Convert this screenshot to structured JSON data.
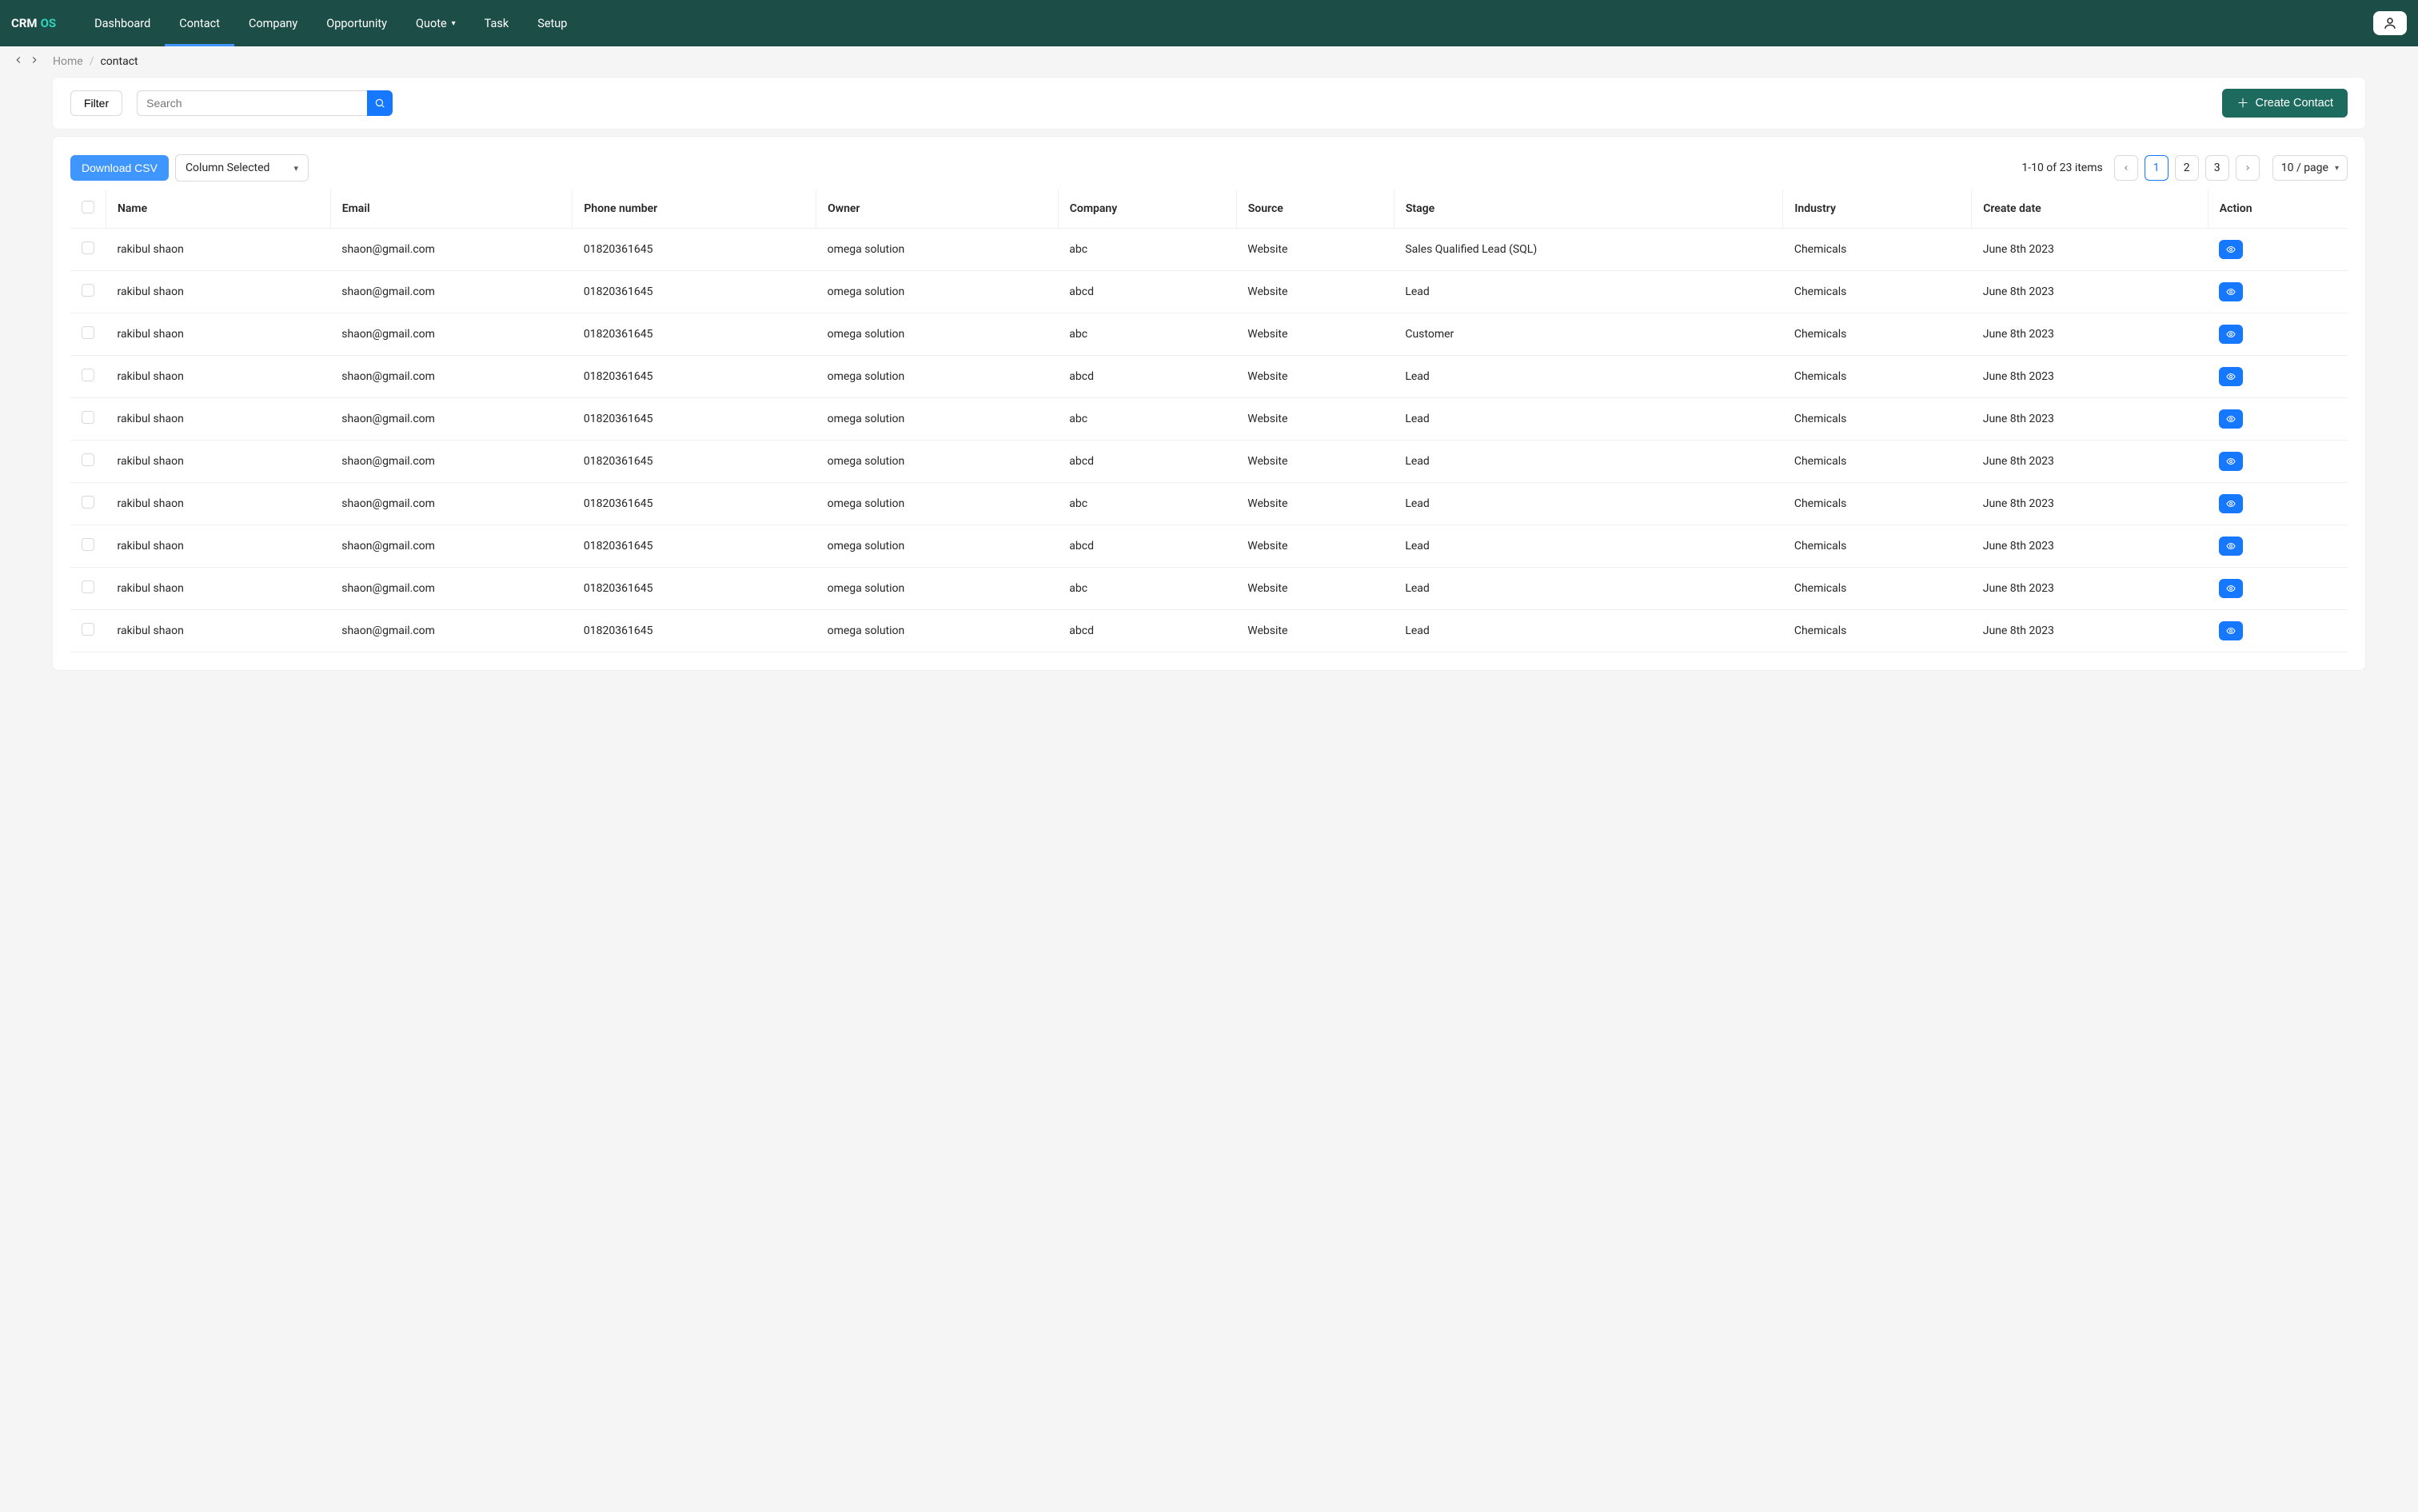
{
  "brand": {
    "crm": "CRM",
    "os": "OS"
  },
  "nav": {
    "items": [
      {
        "label": "Dashboard"
      },
      {
        "label": "Contact",
        "active": true
      },
      {
        "label": "Company"
      },
      {
        "label": "Opportunity"
      },
      {
        "label": "Quote",
        "dropdown": true
      },
      {
        "label": "Task"
      },
      {
        "label": "Setup"
      }
    ]
  },
  "breadcrumb": {
    "home": "Home",
    "current": "contact"
  },
  "toolbar": {
    "filter": "Filter",
    "search_placeholder": "Search",
    "create": "Create Contact"
  },
  "tableTools": {
    "csv": "Download CSV",
    "columnSel": "Column Selected",
    "summary": "1-10 of 23 items",
    "pages": [
      "1",
      "2",
      "3"
    ],
    "activePage": "1",
    "pageSize": "10 / page"
  },
  "columns": [
    "Name",
    "Email",
    "Phone number",
    "Owner",
    "Company",
    "Source",
    "Stage",
    "Industry",
    "Create date",
    "Action"
  ],
  "rows": [
    {
      "name": "rakibul shaon",
      "email": "shaon@gmail.com",
      "phone": "01820361645",
      "owner": "omega solution",
      "company": "abc",
      "source": "Website",
      "stage": "Sales Qualified Lead (SQL)",
      "industry": "Chemicals",
      "date": "June 8th 2023"
    },
    {
      "name": "rakibul shaon",
      "email": "shaon@gmail.com",
      "phone": "01820361645",
      "owner": "omega solution",
      "company": "abcd",
      "source": "Website",
      "stage": "Lead",
      "industry": "Chemicals",
      "date": "June 8th 2023"
    },
    {
      "name": "rakibul shaon",
      "email": "shaon@gmail.com",
      "phone": "01820361645",
      "owner": "omega solution",
      "company": "abc",
      "source": "Website",
      "stage": "Customer",
      "industry": "Chemicals",
      "date": "June 8th 2023"
    },
    {
      "name": "rakibul shaon",
      "email": "shaon@gmail.com",
      "phone": "01820361645",
      "owner": "omega solution",
      "company": "abcd",
      "source": "Website",
      "stage": "Lead",
      "industry": "Chemicals",
      "date": "June 8th 2023"
    },
    {
      "name": "rakibul shaon",
      "email": "shaon@gmail.com",
      "phone": "01820361645",
      "owner": "omega solution",
      "company": "abc",
      "source": "Website",
      "stage": "Lead",
      "industry": "Chemicals",
      "date": "June 8th 2023"
    },
    {
      "name": "rakibul shaon",
      "email": "shaon@gmail.com",
      "phone": "01820361645",
      "owner": "omega solution",
      "company": "abcd",
      "source": "Website",
      "stage": "Lead",
      "industry": "Chemicals",
      "date": "June 8th 2023"
    },
    {
      "name": "rakibul shaon",
      "email": "shaon@gmail.com",
      "phone": "01820361645",
      "owner": "omega solution",
      "company": "abc",
      "source": "Website",
      "stage": "Lead",
      "industry": "Chemicals",
      "date": "June 8th 2023"
    },
    {
      "name": "rakibul shaon",
      "email": "shaon@gmail.com",
      "phone": "01820361645",
      "owner": "omega solution",
      "company": "abcd",
      "source": "Website",
      "stage": "Lead",
      "industry": "Chemicals",
      "date": "June 8th 2023"
    },
    {
      "name": "rakibul shaon",
      "email": "shaon@gmail.com",
      "phone": "01820361645",
      "owner": "omega solution",
      "company": "abc",
      "source": "Website",
      "stage": "Lead",
      "industry": "Chemicals",
      "date": "June 8th 2023"
    },
    {
      "name": "rakibul shaon",
      "email": "shaon@gmail.com",
      "phone": "01820361645",
      "owner": "omega solution",
      "company": "abcd",
      "source": "Website",
      "stage": "Lead",
      "industry": "Chemicals",
      "date": "June 8th 2023"
    }
  ]
}
